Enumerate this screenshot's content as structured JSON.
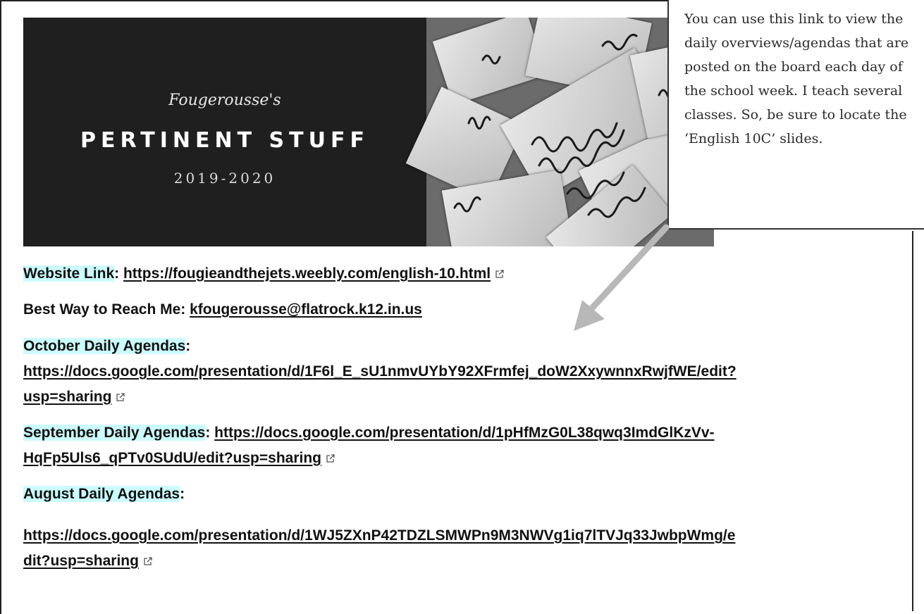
{
  "banner": {
    "owner": "Fougerousse's",
    "title": "PERTINENT STUFF",
    "years": "2019-2020"
  },
  "comment": {
    "text": "You can use this link to view the daily overviews/agendas that are posted on the board each day of the school week. I teach several classes. So, be sure to locate the ‘English 10C’ slides."
  },
  "website": {
    "label": "Website Link",
    "url": "https://fougieandthejets.weebly.com/english-10.html"
  },
  "contact": {
    "label": "Best Way to Reach Me",
    "email_user": "kfougerousse@",
    "email_domain": "flatrock.k12.in.us"
  },
  "october": {
    "label": "October Daily Agendas",
    "url_line1": "https://docs.google.com/presentation/d/1F6l_E_sU1nmvUYbY92XFrmfej_doW2XxywnnxRwjfWE/edit?",
    "url_line2": "usp=sharing"
  },
  "september": {
    "label": "September Daily Agendas",
    "url_line1": "https://docs.google.com/presentation/d/1pHfMzG0L38qwq3ImdGlKzVv-",
    "url_line2": "HqFp5Uls6_qPTv0SUdU/edit?usp=sharing"
  },
  "august": {
    "label": "August Daily Agendas",
    "url_line1": "https://docs.google.com/presentation/d/1WJ5ZXnP42TDZLSMWPn9M3NWVg1iq7lTVJq33JwbpWmg/e",
    "url_line2": "dit?usp=sharing"
  },
  "icons": [
    "external-link-icon",
    "arrow-icon"
  ],
  "colors": {
    "highlight": "#ccfbfd",
    "banner_bg": "#1f1f1f"
  }
}
